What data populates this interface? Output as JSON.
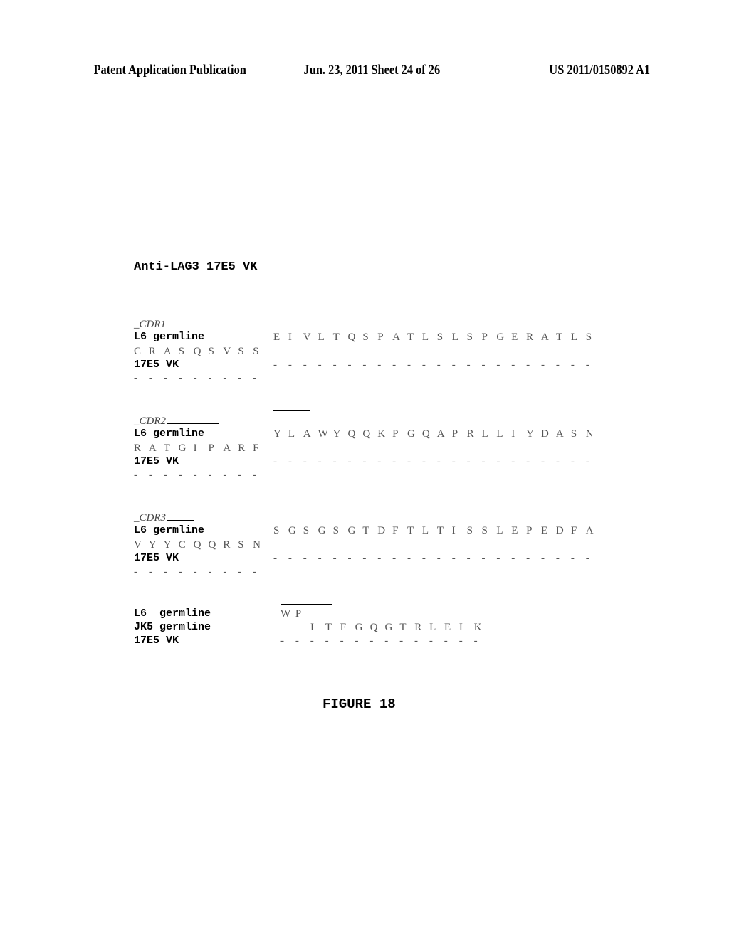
{
  "header": {
    "publication": "Patent Application Publication",
    "date_sheet": "Jun. 23, 2011  Sheet 24 of 26",
    "patent_number": "US 2011/0150892 A1"
  },
  "title": "Anti-LAG3 17E5 VK",
  "blocks": [
    {
      "cdr_label": "CDR1",
      "germline_label": "L6 germline",
      "germline_seq": [
        "E",
        "I",
        "V",
        "L",
        "T",
        "Q",
        "S",
        "P",
        "A",
        "T",
        "L",
        "S",
        "L",
        "S",
        "P",
        "G",
        "E",
        "R",
        "A",
        "T",
        "L",
        "S"
      ],
      "germline_wrap": [
        "C",
        "R",
        "A",
        "S",
        "Q",
        "S",
        "V",
        "S",
        "S"
      ],
      "vk_label": "17E5 VK",
      "vk_seq": [
        "-",
        "-",
        "-",
        "-",
        "-",
        "-",
        "-",
        "-",
        "-",
        "-",
        "-",
        "-",
        "-",
        "-",
        "-",
        "-",
        "-",
        "-",
        "-",
        "-",
        "-",
        "-"
      ],
      "vk_wrap": [
        "-",
        "-",
        "-",
        "-",
        "-",
        "-",
        "-",
        "-",
        "-"
      ]
    },
    {
      "cdr_label": "CDR2",
      "germline_label": "L6 germline",
      "germline_seq": [
        "Y",
        "L",
        "A",
        "W",
        "Y",
        "Q",
        "Q",
        "K",
        "P",
        "G",
        "Q",
        "A",
        "P",
        "R",
        "L",
        "L",
        "I",
        "Y",
        "D",
        "A",
        "S",
        "N"
      ],
      "germline_wrap": [
        "R",
        "A",
        "T",
        "G",
        "I",
        "P",
        "A",
        "R",
        "F"
      ],
      "vk_label": "17E5 VK",
      "vk_seq": [
        "-",
        "-",
        "-",
        "-",
        "-",
        "-",
        "-",
        "-",
        "-",
        "-",
        "-",
        "-",
        "-",
        "-",
        "-",
        "-",
        "-",
        "-",
        "-",
        "-",
        "-",
        "-"
      ],
      "vk_wrap": [
        "-",
        "-",
        "-",
        "-",
        "-",
        "-",
        "-",
        "-",
        "-"
      ]
    },
    {
      "cdr_label": "CDR3",
      "germline_label": "L6 germline",
      "germline_seq": [
        "S",
        "G",
        "S",
        "G",
        "S",
        "G",
        "T",
        "D",
        "F",
        "T",
        "L",
        "T",
        "I",
        "S",
        "S",
        "L",
        "E",
        "P",
        "E",
        "D",
        "F",
        "A"
      ],
      "germline_wrap": [
        "V",
        "Y",
        "Y",
        "C",
        "Q",
        "Q",
        "R",
        "S",
        "N"
      ],
      "vk_label": "17E5 VK",
      "vk_seq": [
        "-",
        "-",
        "-",
        "-",
        "-",
        "-",
        "-",
        "-",
        "-",
        "-",
        "-",
        "-",
        "-",
        "-",
        "-",
        "-",
        "-",
        "-",
        "-",
        "-",
        "-",
        "-"
      ],
      "vk_wrap": [
        "-",
        "-",
        "-",
        "-",
        "-",
        "-",
        "-",
        "-",
        "-"
      ]
    }
  ],
  "final_block": {
    "l6_label": "L6  germline",
    "l6_seq": [
      "W",
      "P"
    ],
    "jk5_label": "JK5 germline",
    "jk5_seq": [
      "I",
      "T",
      "F",
      "G",
      "Q",
      "G",
      "T",
      "R",
      "L",
      "E",
      "I",
      "K"
    ],
    "vk_label": "17E5 VK",
    "vk_seq": [
      "-",
      "-",
      "-",
      "-",
      "-",
      "-",
      "-",
      "-",
      "-",
      "-",
      "-",
      "-",
      "-",
      "-"
    ]
  },
  "figure_label": "FIGURE 18"
}
